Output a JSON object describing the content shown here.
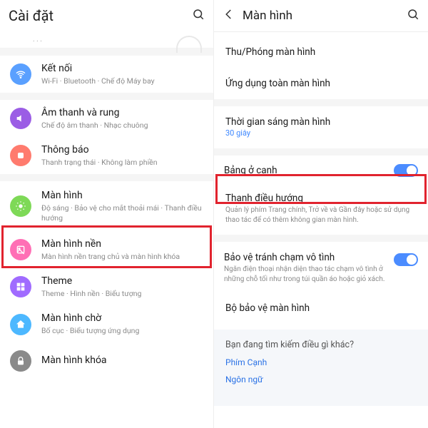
{
  "left": {
    "header_title": "Cài đặt",
    "items": {
      "connect": {
        "title": "Kết nối",
        "sub": "Wi-Fi · Bluetooth · Chế độ Máy bay"
      },
      "sound": {
        "title": "Âm thanh và rung",
        "sub": "Chế độ âm thanh · Nhạc chuông"
      },
      "notif": {
        "title": "Thông báo",
        "sub": "Thanh trạng thái · Không làm phiền"
      },
      "display": {
        "title": "Màn hình",
        "sub": "Độ sáng · Bảo vệ cho mắt thoải mái · Thanh điều hướng"
      },
      "wall": {
        "title": "Màn hình nền",
        "sub": "Màn hình nền trang chủ và màn hình khóa"
      },
      "theme": {
        "title": "Theme",
        "sub": "Theme · Hình nền · Biểu tượng"
      },
      "home": {
        "title": "Màn hình chờ",
        "sub": "Bố cục · Biểu tượng ứng dụng"
      },
      "lock": {
        "title": "Màn hình khóa"
      }
    }
  },
  "right": {
    "header_title": "Màn hình",
    "zoom": {
      "title": "Thu/Phóng màn hình"
    },
    "fullapp": {
      "title": "Ứng dụng toàn màn hình"
    },
    "timeout": {
      "title": "Thời gian sáng màn hình",
      "sub": "30 giây"
    },
    "edge": {
      "title": "Bảng ở cạnh"
    },
    "nav": {
      "title": "Thanh điều hướng",
      "sub": "Quản lý phím Trang chính, Trở về và Gần đây hoặc sử dụng thao tác để có thêm không gian màn hình."
    },
    "accident": {
      "title": "Bảo vệ tránh chạm vô tình",
      "sub": "Ngăn điện thoại nhận diện thao tác chạm vô tình ở những chỗ tối như trong túi quần áo hoặc giỏ xách."
    },
    "protector": {
      "title": "Bộ bảo vệ màn hình"
    },
    "footer": {
      "question": "Bạn đang tìm kiếm điều gì khác?",
      "link1": "Phím Cạnh",
      "link2": "Ngôn ngữ"
    }
  }
}
